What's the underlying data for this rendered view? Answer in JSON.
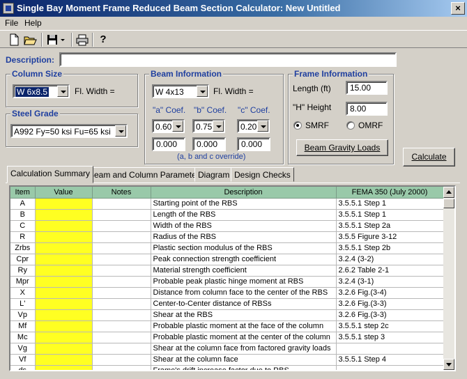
{
  "window": {
    "title": "Single Bay Moment Frame Reduced Beam Section Calculator:  New Untitled",
    "close_glyph": "×"
  },
  "menu": {
    "file": "File",
    "help": "Help"
  },
  "toolbar": {
    "help_glyph": "?"
  },
  "description": {
    "label": "Description:",
    "value": ""
  },
  "column_size": {
    "title": "Column Size",
    "selected": "W 6x8.5",
    "flange_width_label": "Fl. Width ="
  },
  "steel_grade": {
    "title": "Steel Grade",
    "selected": "A992  Fy=50 ksi  Fu=65 ksi"
  },
  "beam_information": {
    "title": "Beam Information",
    "selected": "W 4x13",
    "flange_width_label": "Fl. Width =",
    "coef_a_label": "\"a\" Coef.",
    "coef_b_label": "\"b\" Coef.",
    "coef_c_label": "\"c\" Coef.",
    "coef_a": "0.60",
    "coef_b": "0.75",
    "coef_c": "0.20",
    "override_a": "0.000",
    "override_b": "0.000",
    "override_c": "0.000",
    "override_note": "(a, b and c  override)"
  },
  "frame_information": {
    "title": "Frame Information",
    "length_label": "Length (ft)",
    "length_value": "15.00",
    "height_label": "\"H\" Height",
    "height_value": "8.00",
    "smrf_label": "SMRF",
    "omrf_label": "OMRF",
    "selected": "SMRF",
    "gravity_button": "Beam Gravity Loads"
  },
  "calculate_button": "Calculate",
  "tabs": [
    {
      "label": "Calculation Summary",
      "active": true
    },
    {
      "label": "Beam and Column Parameters",
      "active": false
    },
    {
      "label": "Diagram",
      "active": false
    },
    {
      "label": "Design Checks",
      "active": false
    }
  ],
  "grid": {
    "columns": [
      "Item",
      "Value",
      "Notes",
      "Description",
      "FEMA 350 (July 2000)"
    ],
    "rows": [
      {
        "item": "A",
        "value": "",
        "notes": "",
        "description": "Starting point of the RBS",
        "fema": "3.5.5.1 Step 1"
      },
      {
        "item": "B",
        "value": "",
        "notes": "",
        "description": "Length of the RBS",
        "fema": "3.5.5.1 Step 1"
      },
      {
        "item": "C",
        "value": "",
        "notes": "",
        "description": "Width of the RBS",
        "fema": "3.5.5.1 Step 2a"
      },
      {
        "item": "R",
        "value": "",
        "notes": "",
        "description": "Radius of the RBS",
        "fema": "3.5.5  Figure 3-12"
      },
      {
        "item": "Zrbs",
        "value": "",
        "notes": "",
        "description": "Plastic section modulus of the RBS",
        "fema": "3.5.5.1 Step 2b"
      },
      {
        "item": "Cpr",
        "value": "",
        "notes": "",
        "description": "Peak connection strength coefficient",
        "fema": "3.2.4 (3-2)"
      },
      {
        "item": "Ry",
        "value": "",
        "notes": "",
        "description": "Material strength coefficient",
        "fema": "2.6.2 Table 2-1"
      },
      {
        "item": "Mpr",
        "value": "",
        "notes": "",
        "description": "Probable peak plastic hinge moment at RBS",
        "fema": "3.2.4 (3-1)"
      },
      {
        "item": "X",
        "value": "",
        "notes": "",
        "description": "Distance from column face to the center of the RBS",
        "fema": "3.2.6 Fig.(3-4)"
      },
      {
        "item": "L'",
        "value": "",
        "notes": "",
        "description": "Center-to-Center distance of RBSs",
        "fema": "3.2.6 Fig.(3-3)"
      },
      {
        "item": "Vp",
        "value": "",
        "notes": "",
        "description": "Shear at the RBS",
        "fema": "3.2.6 Fig.(3-3)"
      },
      {
        "item": "Mf",
        "value": "",
        "notes": "",
        "description": "Probable plastic moment at the face of the column",
        "fema": "3.5.5.1 step 2c"
      },
      {
        "item": "Mc",
        "value": "",
        "notes": "",
        "description": "Probable plastic moment at the center of the column",
        "fema": "3.5.5.1 step 3"
      },
      {
        "item": "Vg",
        "value": "",
        "notes": "",
        "description": "Shear at the column face from factored gravity loads",
        "fema": ""
      },
      {
        "item": "Vf",
        "value": "",
        "notes": "",
        "description": "Shear at the column face",
        "fema": "3.5.5.1 Step 4"
      },
      {
        "item": "ds",
        "value": "",
        "notes": "",
        "description": "Frame's drift increase factor due to RBS",
        "fema": ""
      }
    ]
  },
  "colors": {
    "value_cell": "#ffff22",
    "header": "#99c9a9",
    "group_title": "#1f3f9f"
  }
}
